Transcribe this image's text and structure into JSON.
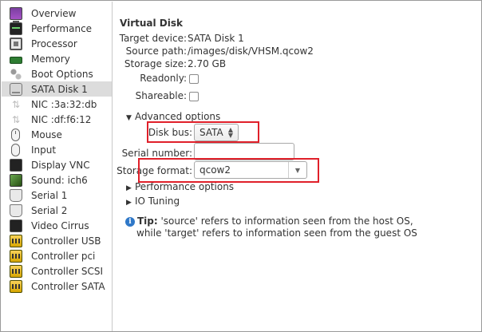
{
  "sidebar": {
    "items": [
      {
        "label": "Overview",
        "icon": "monitor-icon"
      },
      {
        "label": "Performance",
        "icon": "performance-icon"
      },
      {
        "label": "Processor",
        "icon": "processor-icon"
      },
      {
        "label": "Memory",
        "icon": "memory-icon"
      },
      {
        "label": "Boot Options",
        "icon": "boot-options-icon"
      },
      {
        "label": "SATA Disk 1",
        "icon": "disk-icon",
        "selected": true
      },
      {
        "label": "NIC :3a:32:db",
        "icon": "nic-icon"
      },
      {
        "label": "NIC :df:f6:12",
        "icon": "nic-icon"
      },
      {
        "label": "Mouse",
        "icon": "mouse-icon"
      },
      {
        "label": "Input",
        "icon": "input-icon"
      },
      {
        "label": "Display VNC",
        "icon": "display-icon"
      },
      {
        "label": "Sound: ich6",
        "icon": "sound-icon"
      },
      {
        "label": "Serial 1",
        "icon": "serial-icon"
      },
      {
        "label": "Serial 2",
        "icon": "serial-icon"
      },
      {
        "label": "Video Cirrus",
        "icon": "video-icon"
      },
      {
        "label": "Controller USB",
        "icon": "controller-icon"
      },
      {
        "label": "Controller pci",
        "icon": "controller-icon"
      },
      {
        "label": "Controller SCSI",
        "icon": "controller-icon"
      },
      {
        "label": "Controller SATA",
        "icon": "controller-icon"
      }
    ]
  },
  "main": {
    "title": "Virtual Disk",
    "target_device_label": "Target device:",
    "target_device_value": "SATA Disk 1",
    "source_path_label": "Source path:",
    "source_path_value": "/images/disk/VHSM.qcow2",
    "storage_size_label": "Storage size:",
    "storage_size_value": "2.70 GB",
    "readonly_label": "Readonly:",
    "readonly_checked": false,
    "shareable_label": "Shareable:",
    "shareable_checked": false,
    "advanced_options_label": "Advanced options",
    "disk_bus_label": "Disk bus:",
    "disk_bus_value": "SATA",
    "serial_number_label": "Serial number:",
    "serial_number_value": "",
    "storage_format_label": "Storage format:",
    "storage_format_value": "qcow2",
    "performance_options_label": "Performance options",
    "io_tuning_label": "IO Tuning",
    "tip_bold": "Tip:",
    "tip_line1": " 'source' refers to information seen from the host OS,",
    "tip_line2": "while 'target' refers to information seen from the guest OS"
  },
  "colors": {
    "highlight_box": "#e0202a",
    "selected_row": "#dcdcdc",
    "info_icon": "#2f78c8"
  }
}
